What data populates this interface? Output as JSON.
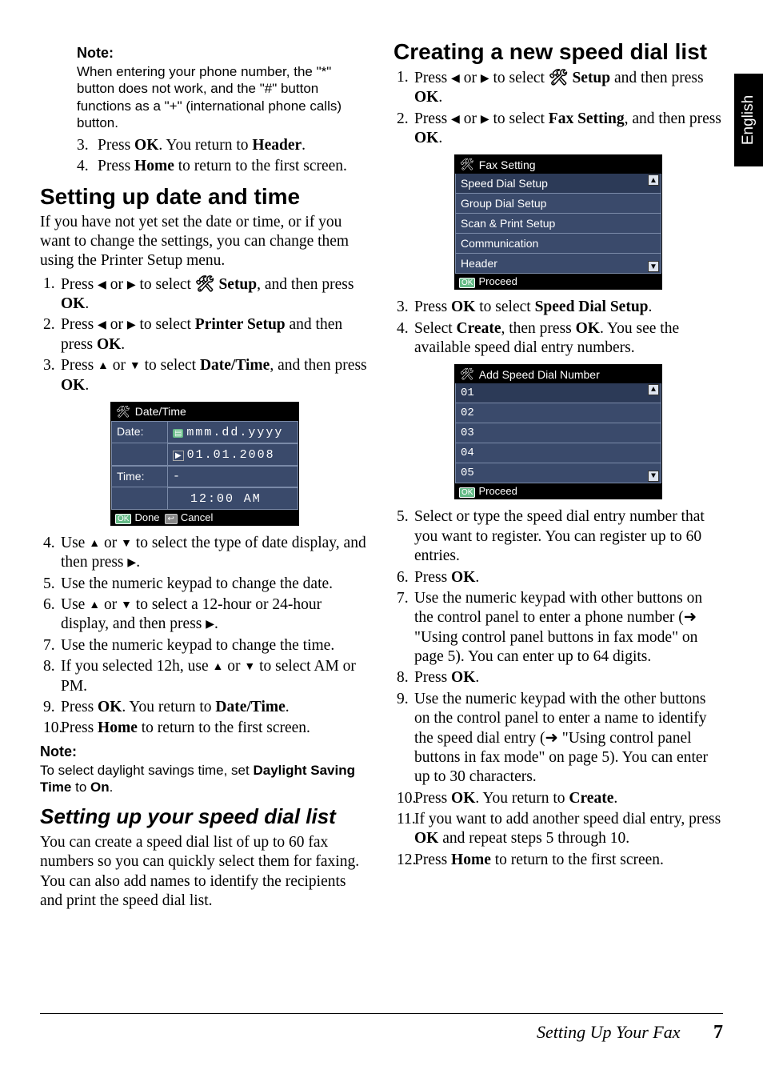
{
  "lang_tab": "English",
  "footer_title": "Setting Up Your Fax",
  "footer_page": "7",
  "left": {
    "note1_title": "Note:",
    "note1_body": "When entering your phone number, the \"*\" button does not work, and the \"#\" button functions as a \"+\" (international phone calls) button.",
    "s3_a": "Press ",
    "s3_b": "OK",
    "s3_c": ". You return to ",
    "s3_d": "Header",
    "s3_e": ".",
    "s4_a": "Press ",
    "s4_b": "Home",
    "s4_c": " to return to the first screen.",
    "h_date": "Setting up date and time",
    "p_date": "If you have not yet set the date or time, or if you want to change the settings, you can change them using the Printer Setup menu.",
    "d1_a": "Press ",
    "d1_b": " or ",
    "d1_c": " to select ",
    "d1_d": " Setup",
    "d1_e": ", and then press ",
    "d1_f": "OK",
    "d1_g": ".",
    "d2_a": "Press ",
    "d2_b": " or ",
    "d2_c": " to select ",
    "d2_d": "Printer Setup",
    "d2_e": " and then press ",
    "d2_f": "OK",
    "d2_g": ".",
    "d3_a": "Press ",
    "d3_b": " or ",
    "d3_c": " to select ",
    "d3_d": "Date/Time",
    "d3_e": ", and then press ",
    "d3_f": "OK",
    "d3_g": ".",
    "lcd1_title": "Date/Time",
    "lcd1_datelbl": "Date:",
    "lcd1_fmt": "mmm.dd.yyyy",
    "lcd1_date": "01.01.2008",
    "lcd1_timelbl": "Time:",
    "lcd1_blank": "-",
    "lcd1_time": "12:00",
    "lcd1_ampm": "AM",
    "lcd1_done": "Done",
    "lcd1_cancel": "Cancel",
    "lcd1_ok": "OK",
    "lcd1_back": "↩",
    "d4_a": "Use ",
    "d4_b": " or ",
    "d4_c": " to select the type of date display, and then press ",
    "d4_d": ".",
    "d5": "Use the numeric keypad to change the date.",
    "d6_a": "Use ",
    "d6_b": " or ",
    "d6_c": " to select a 12-hour or 24-hour display, and then press ",
    "d6_d": ".",
    "d7": "Use the numeric keypad to change the time.",
    "d8_a": "If you selected 12h, use ",
    "d8_b": " or ",
    "d8_c": " to select AM or PM.",
    "d9_a": "Press ",
    "d9_b": "OK",
    "d9_c": ". You return to ",
    "d9_d": "Date/Time",
    "d9_e": ".",
    "d10_a": "Press ",
    "d10_b": "Home",
    "d10_c": " to return to the first screen.",
    "note2_title": "Note:",
    "note2_a": "To select daylight savings time, set ",
    "note2_b": "Daylight Saving Time",
    "note2_c": " to ",
    "note2_d": "On",
    "note2_e": ".",
    "h_speed": "Setting up your speed dial list",
    "p_speed": "You can create a speed dial list of up to 60 fax numbers so you can quickly select them for faxing. You can also add names to identify the recipients and print the speed dial list."
  },
  "right": {
    "h_create": "Creating a new speed dial list",
    "c1_a": "Press ",
    "c1_b": " or ",
    "c1_c": " to select ",
    "c1_d": " Setup",
    "c1_e": " and then press ",
    "c1_f": "OK",
    "c1_g": ".",
    "c2_a": "Press ",
    "c2_b": " or ",
    "c2_c": " to select ",
    "c2_d": "Fax Setting",
    "c2_e": ", and then press ",
    "c2_f": "OK",
    "c2_g": ".",
    "lcd2_title": "Fax Setting",
    "lcd2_i1": "Speed Dial Setup",
    "lcd2_i2": "Group Dial Setup",
    "lcd2_i3": "Scan & Print Setup",
    "lcd2_i4": "Communication",
    "lcd2_i5": "Header",
    "lcd2_proceed": "Proceed",
    "lcd2_ok": "OK",
    "c3_a": "Press ",
    "c3_b": "OK",
    "c3_c": " to select ",
    "c3_d": "Speed Dial Setup",
    "c3_e": ".",
    "c4_a": "Select ",
    "c4_b": "Create",
    "c4_c": ", then press ",
    "c4_d": "OK",
    "c4_e": ". You see the available speed dial entry numbers.",
    "lcd3_title": "Add Speed Dial Number",
    "lcd3_1": "01",
    "lcd3_2": "02",
    "lcd3_3": "03",
    "lcd3_4": "04",
    "lcd3_5": "05",
    "lcd3_proceed": "Proceed",
    "lcd3_ok": "OK",
    "c5": "Select or type the speed dial entry number that you want to register. You can register up to 60 entries.",
    "c6_a": "Press ",
    "c6_b": "OK",
    "c6_c": ".",
    "c7_a": "Use the numeric keypad with other buttons on the control panel to enter a phone number (",
    "c7_b": " \"Using control panel buttons in fax mode\" on page 5). You can enter up to 64 digits.",
    "c8_a": "Press ",
    "c8_b": "OK",
    "c8_c": ".",
    "c9_a": "Use the numeric keypad with the other buttons on the control panel to enter a name to identify the speed dial entry (",
    "c9_b": " \"Using control panel buttons in fax mode\" on page 5). You can enter up to 30 characters.",
    "c10_a": "Press ",
    "c10_b": "OK",
    "c10_c": ". You return to ",
    "c10_d": "Create",
    "c10_e": ".",
    "c11_a": "If you want to add another speed dial entry, press ",
    "c11_b": "OK",
    "c11_c": " and repeat steps 5 through 10.",
    "c12_a": "Press ",
    "c12_b": "Home",
    "c12_c": " to return to the first screen."
  }
}
